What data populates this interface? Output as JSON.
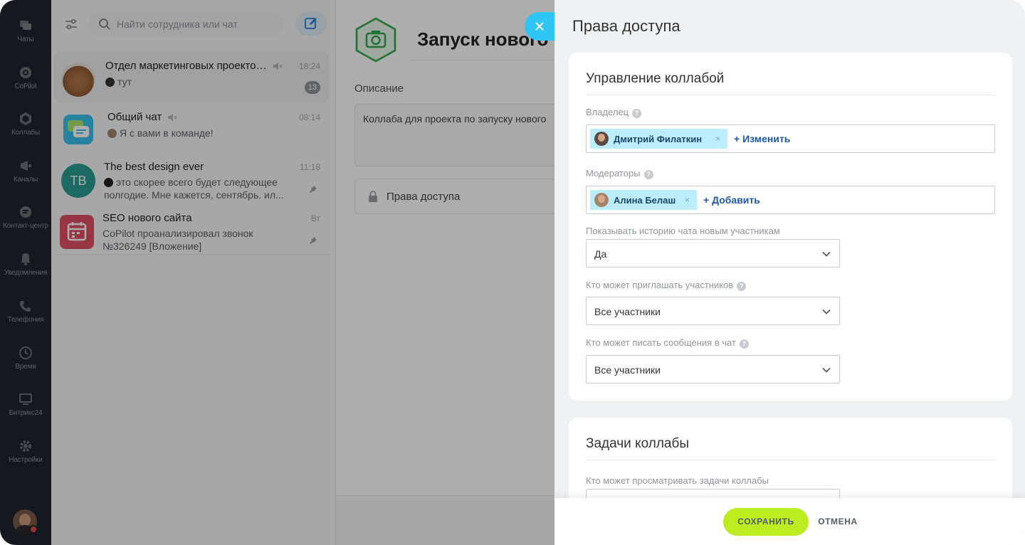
{
  "nav": {
    "items": [
      {
        "label": "Чаты",
        "icon": "chats-icon"
      },
      {
        "label": "CoPilot",
        "icon": "copilot-icon"
      },
      {
        "label": "Коллабы",
        "icon": "collabs-icon"
      },
      {
        "label": "Каналы",
        "icon": "channels-icon"
      },
      {
        "label": "Контакт-центр",
        "icon": "contact-center-icon"
      },
      {
        "label": "Уведомления",
        "icon": "bell-icon"
      },
      {
        "label": "Телефония",
        "icon": "phone-icon"
      },
      {
        "label": "Время",
        "icon": "clock-icon"
      },
      {
        "label": "Битрикс24",
        "icon": "monitor-icon"
      },
      {
        "label": "Настройки",
        "icon": "gear-icon"
      }
    ]
  },
  "chatlist": {
    "search_placeholder": "Найти сотрудника или чат",
    "chats": [
      {
        "title": "Отдел маркетинговых проекто…",
        "time": "18:24",
        "preview": "тут",
        "badge": "13"
      },
      {
        "title": "Общий чат",
        "time": "08:14",
        "preview": "Я с вами в команде!"
      },
      {
        "title": "The best design ever",
        "time": "11:18",
        "initials": "TB",
        "preview": "это скорее всего будет следующее полгодие. Мне кажется, сентябрь. ил..."
      },
      {
        "title": "SEO нового сайта",
        "time": "Вт",
        "preview": "CoPilot проанализировал звонок №326249 [Вложение]"
      }
    ]
  },
  "middle": {
    "title": "Запуск нового",
    "description_label": "Описание",
    "description_text": "Коллаба для проекта по запуску нового",
    "access_label": "Права доступа"
  },
  "panel": {
    "title": "Права доступа",
    "section1": {
      "title": "Управление коллабой",
      "owner_label": "Владелец",
      "owner_name": "Дмитрий Филаткин",
      "owner_action": "+ Изменить",
      "moderators_label": "Модераторы",
      "moderator_name": "Алина Белаш",
      "moderators_action": "+ Добавить",
      "history_label": "Показывать историю чата новым участникам",
      "history_value": "Да",
      "invite_label": "Кто может приглашать участников",
      "invite_value": "Все участники",
      "write_label": "Кто может писать сообщения в чат",
      "write_value": "Все участники"
    },
    "section2": {
      "title": "Задачи коллабы",
      "view_tasks_label": "Кто может просматривать задачи коллабы"
    },
    "save_label": "СОХРАНИТЬ",
    "cancel_label": "ОТМЕНА",
    "help_glyph": "?",
    "remove_glyph": "×"
  },
  "colors": {
    "nav_bg": "#20262e",
    "accent_blue": "#2fc6f6",
    "save_green": "#bbed21",
    "tag_bg": "#bcedfc",
    "link_blue": "#1f58a8"
  }
}
